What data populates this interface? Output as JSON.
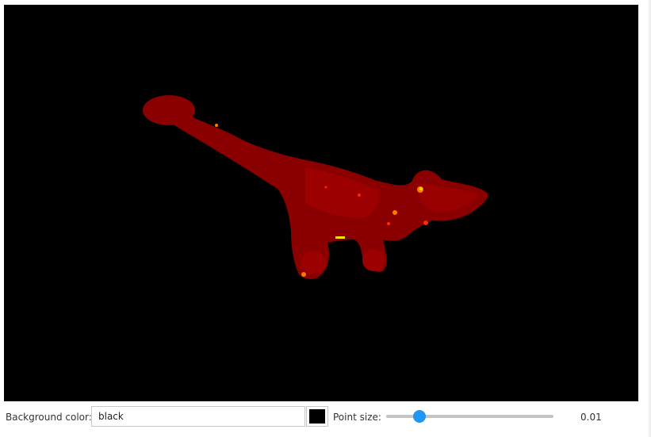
{
  "viewer": {
    "background": "#000000",
    "subject": "point cloud",
    "colormap": [
      "#8a0000",
      "#b30000",
      "#ff2a00",
      "#ff7b00",
      "#ffe100"
    ]
  },
  "controls": {
    "background_color_label": "Background color:",
    "background_color_value": "black",
    "swatch_color": "#000000",
    "point_size_label": "Point size:",
    "point_size_value": "0.01",
    "point_size_fraction": 0.2
  }
}
